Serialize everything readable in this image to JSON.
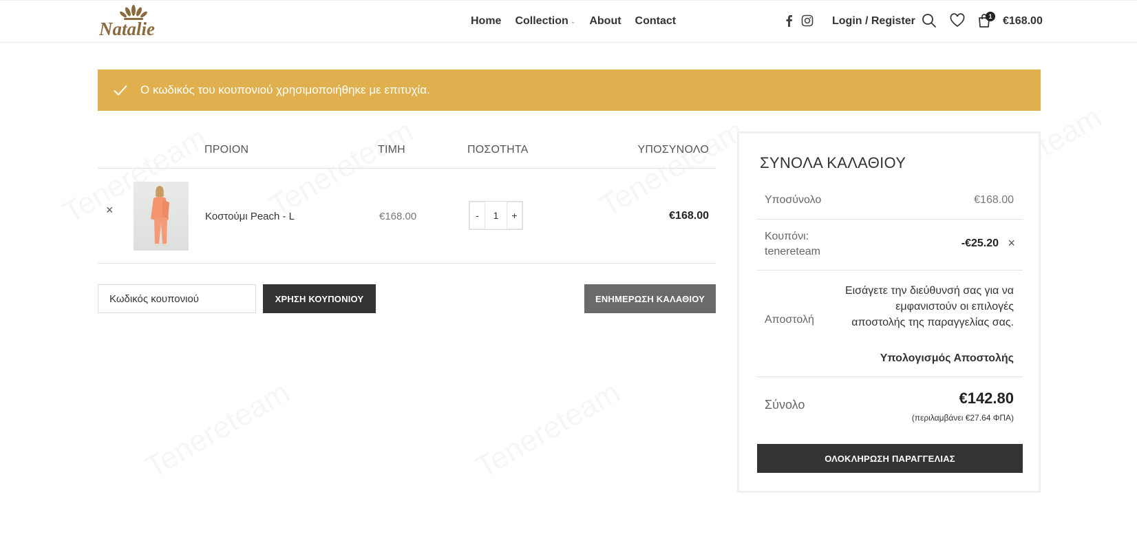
{
  "header": {
    "logo_text": "Natalie",
    "nav": [
      "Home",
      "Collection",
      "About",
      "Contact"
    ],
    "login_label": "Login / Register",
    "cart_count": "1",
    "cart_total": "€168.00"
  },
  "notice": {
    "message": "Ο κωδικός του κουπονιού χρησιμοποιήθηκε με επιτυχία."
  },
  "cart": {
    "headers": {
      "product": "ΠΡΟΙΟΝ",
      "price": "ΤΙΜΗ",
      "quantity": "ΠΟΣΟΤΗΤΑ",
      "subtotal": "ΥΠΟΣΥΝΟΛΟ"
    },
    "items": [
      {
        "name": "Κοστούμι Peach - L",
        "price": "€168.00",
        "quantity": "1",
        "subtotal": "€168.00"
      }
    ],
    "remove_glyph": "×",
    "qty_minus": "-",
    "qty_plus": "+",
    "coupon_placeholder": "Κωδικός κουπονιού",
    "apply_coupon_label": "ΧΡΗΣΗ ΚΟΥΠΟΝΙΟΥ",
    "update_cart_label": "ΕΝΗΜΕΡΩΣΗ ΚΑΛΑΘΙΟΥ"
  },
  "totals": {
    "title": "ΣΥΝΟΛΑ ΚΑΛΑΘΙΟΥ",
    "subtotal_label": "Υποσύνολο",
    "subtotal_value": "€168.00",
    "coupon_label_1": "Κουπόνι:",
    "coupon_label_2": "tenereteam",
    "coupon_value": "-€25.20",
    "shipping_label": "Αποστολή",
    "shipping_text": "Εισάγετε την διεύθυνσή σας για να εμφανιστούν οι επιλογές αποστολής της παραγγελίας σας.",
    "shipping_calc_label": "Υπολογισμός Αποστολής",
    "total_label": "Σύνολο",
    "total_value": "€142.80",
    "vat_note": "(περιλαμβάνει €27.64 ΦΠΑ)",
    "checkout_label": "ΟΛΟΚΛΗΡΩΣΗ ΠΑΡΑΓΓΕΛΙΑΣ"
  },
  "watermark_text": "Tenereteam",
  "colors": {
    "accent": "#e0b04e",
    "dark_button": "#333333",
    "grey_button": "#6a6a6a",
    "logo": "#8b6a3e"
  }
}
